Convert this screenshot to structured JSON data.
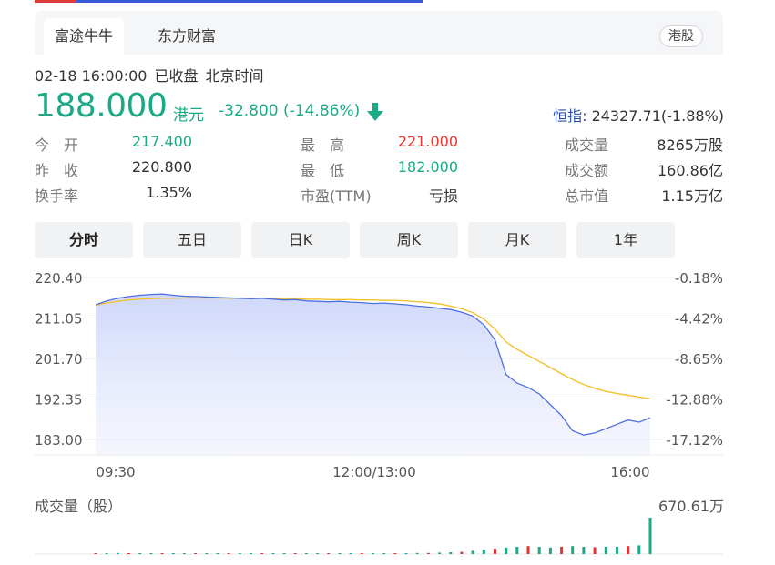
{
  "source_tabs": [
    "富途牛牛",
    "东方财富"
  ],
  "market_badge": "港股",
  "status": {
    "datetime": "02-18 16:00:00",
    "state": "已收盘",
    "timezone": "北京时间"
  },
  "quote": {
    "price": "188.000",
    "currency": "港元",
    "change": "-32.800 (-14.86%)",
    "direction": "down",
    "color_down": "#1aaa85",
    "color_up": "#e33333"
  },
  "index": {
    "label": "恒指:",
    "value": "24327.71(-1.88%)"
  },
  "stats": [
    [
      {
        "label": "今　开",
        "value": "217.400",
        "color": "green"
      },
      {
        "label": "最　高",
        "value": "221.000",
        "color": "red"
      },
      {
        "label": "成交量",
        "value": "8265万股",
        "color": ""
      }
    ],
    [
      {
        "label": "昨　收",
        "value": "220.800",
        "color": ""
      },
      {
        "label": "最　低",
        "value": "182.000",
        "color": "green"
      },
      {
        "label": "成交额",
        "value": "160.86亿",
        "color": ""
      }
    ],
    [
      {
        "label": "换手率",
        "value": "1.35%",
        "color": ""
      },
      {
        "label": "市盈(TTM)",
        "value": "亏损",
        "color": ""
      },
      {
        "label": "总市值",
        "value": "1.15万亿",
        "color": ""
      }
    ]
  ],
  "period_tabs": [
    "分时",
    "五日",
    "日K",
    "周K",
    "月K",
    "1年"
  ],
  "active_period": 0,
  "chart_data": {
    "type": "line",
    "y_left_ticks": [
      "220.40",
      "211.05",
      "201.70",
      "192.35",
      "183.00"
    ],
    "y_right_ticks": [
      "-0.18%",
      "-4.42%",
      "-8.65%",
      "-12.88%",
      "-17.12%"
    ],
    "x_ticks": [
      "09:30",
      "12:00/13:00",
      "16:00"
    ],
    "ylim": [
      183.0,
      220.4
    ],
    "grid": true,
    "series": [
      {
        "role": "price",
        "color": "#4f6fe0",
        "values": [
          214.1,
          215.0,
          215.6,
          216.0,
          216.3,
          216.5,
          216.6,
          216.3,
          216.1,
          216.0,
          215.9,
          215.8,
          215.7,
          215.6,
          215.5,
          215.6,
          215.4,
          215.2,
          215.3,
          215.0,
          214.9,
          214.8,
          214.9,
          214.7,
          214.6,
          214.4,
          214.5,
          214.3,
          214.1,
          213.8,
          213.6,
          213.3,
          213.0,
          212.4,
          211.5,
          209.5,
          206.0,
          198.0,
          196.0,
          195.0,
          193.5,
          191.0,
          188.5,
          185.0,
          184.0,
          184.5,
          185.5,
          186.5,
          187.5,
          187.0,
          188.0
        ]
      },
      {
        "role": "average",
        "color": "#f2c12e",
        "values": [
          214.0,
          214.5,
          214.9,
          215.2,
          215.4,
          215.5,
          215.6,
          215.6,
          215.7,
          215.7,
          215.7,
          215.7,
          215.6,
          215.6,
          215.6,
          215.6,
          215.5,
          215.5,
          215.5,
          215.4,
          215.4,
          215.3,
          215.3,
          215.3,
          215.2,
          215.2,
          215.1,
          215.1,
          215.0,
          214.8,
          214.6,
          214.3,
          213.8,
          213.2,
          212.3,
          210.8,
          208.5,
          205.5,
          203.8,
          202.4,
          201.0,
          199.6,
          198.2,
          196.8,
          195.7,
          194.8,
          194.1,
          193.6,
          193.2,
          192.8,
          192.4
        ]
      }
    ]
  },
  "volume": {
    "label": "成交量（股）",
    "max_label": "670.61万",
    "bars": [
      0.02,
      0.02,
      0.03,
      0.02,
      0.02,
      0.02,
      0.02,
      0.02,
      0.02,
      0.02,
      0.02,
      0.02,
      0.02,
      0.02,
      0.02,
      0.02,
      0.02,
      0.02,
      0.02,
      0.02,
      0.02,
      0.02,
      0.02,
      0.02,
      0.02,
      0.02,
      0.02,
      0.02,
      0.02,
      0.03,
      0.03,
      0.04,
      0.05,
      0.06,
      0.09,
      0.12,
      0.15,
      0.18,
      0.2,
      0.22,
      0.2,
      0.18,
      0.2,
      0.22,
      0.2,
      0.19,
      0.2,
      0.2,
      0.22,
      0.24,
      1.0
    ]
  }
}
